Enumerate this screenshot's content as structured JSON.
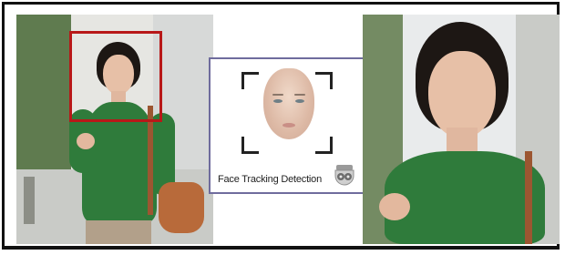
{
  "detection_card": {
    "label": "Face Tracking Detection",
    "icon": "security-camera-icon"
  },
  "colors": {
    "tracking_box": "#b81818",
    "card_border": "#6f6c9d",
    "shirt_green": "#2f7b3b",
    "frame": "#111111"
  }
}
